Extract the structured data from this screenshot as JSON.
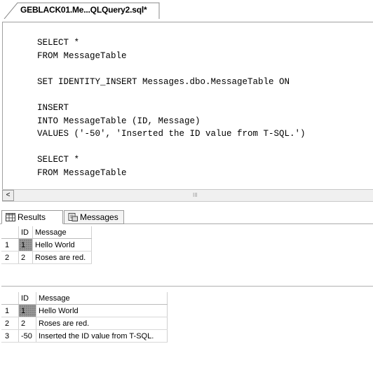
{
  "tab": {
    "title": "GEBLACK01.Me...QLQuery2.sql*"
  },
  "editor": {
    "lines": [
      "SELECT *",
      "FROM MessageTable",
      "",
      "SET IDENTITY_INSERT Messages.dbo.MessageTable ON",
      "",
      "INSERT",
      "INTO MessageTable (ID, Message)",
      "VALUES ('-50', 'Inserted the ID value from T-SQL.')",
      "",
      "SELECT *",
      "FROM MessageTable"
    ]
  },
  "scrollbar": {
    "left_arrow": "<",
    "grip": "III"
  },
  "result_tabs": {
    "results": "Results",
    "messages": "Messages"
  },
  "grid1": {
    "columns": [
      "ID",
      "Message"
    ],
    "rows": [
      {
        "n": "1",
        "id": "1",
        "message": "Hello World"
      },
      {
        "n": "2",
        "id": "2",
        "message": "Roses are red."
      }
    ]
  },
  "grid2": {
    "columns": [
      "ID",
      "Message"
    ],
    "rows": [
      {
        "n": "1",
        "id": "1",
        "message": "Hello World"
      },
      {
        "n": "2",
        "id": "2",
        "message": "Roses are red."
      },
      {
        "n": "3",
        "id": "-50",
        "message": "Inserted the ID value from T-SQL."
      }
    ]
  }
}
